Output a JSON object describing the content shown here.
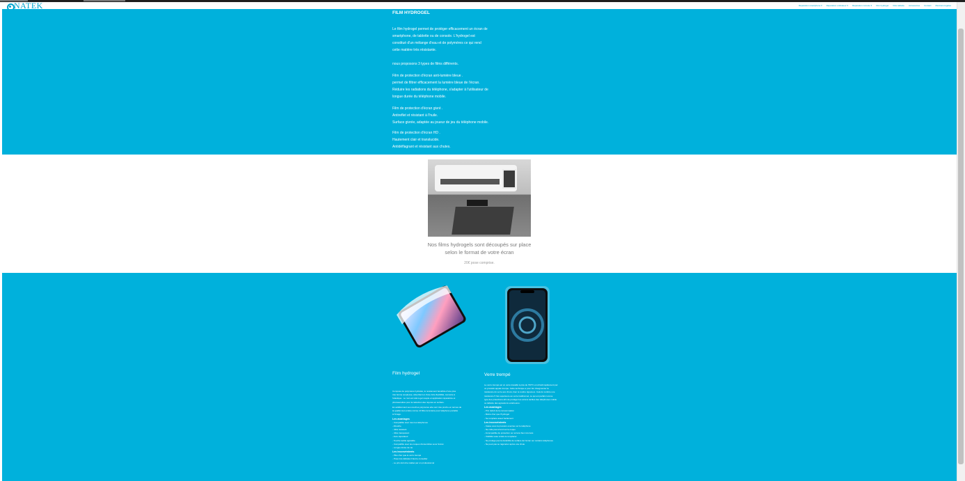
{
  "header": {
    "logo_text": "NATEK",
    "nav": [
      "Réparation smartphone ▾",
      "Réparation ordinateur ▾",
      "Réparation console ▾",
      "Film hydrogel",
      "Vitre tablette",
      "Accessoires",
      "Contact",
      "Mentions légales"
    ]
  },
  "intro": {
    "title": "FILM HYDROGEL",
    "para1_lines": [
      "Le film hydrogel permet de protéger efficacement un écran de",
      "smartphone, de tablette ou de console. L'hydrogel est",
      "constitué d'un mélange d'eau et de polymères ce qui rend",
      "cette matière très résistante."
    ],
    "para2": "nous proposons 3 types de films différents.",
    "para3_lines": [
      "Film de protection d'écran anti-lumière bleue .",
      "permet de filtrer efficacement la lumière bleue de l'écran.",
      "Réduire les radiations du téléphone, s'adapter à l'utilisateur de",
      "longue durée du téléphone mobile."
    ],
    "para4_lines": [
      "Film de protection d'écran givré .",
      "Antireflet et résistant à l'huile.",
      "Surface givrée, adaptée au joueur de jeu du téléphone mobile."
    ],
    "para5_lines": [
      "Film de protection d'écran HD .",
      "Hautement clair et translucide.",
      "Antidéflagrant et résistant aux chutes."
    ]
  },
  "machine_section": {
    "caption_lines": [
      "Nos films hydrogels sont découpés sur place",
      "selon le format de votre écran"
    ],
    "price": "20€ pose comprise."
  },
  "comparison": {
    "hydrogel": {
      "title": "Film hydrogel",
      "text_a": [
        "Composé de polymères hydratés, le revêtement bénéficie d'une plus",
        "très bonne souplesse, absorbant et d'une forte flexibilité, mémoire à",
        "l'élastique . Le mot est relié à gel souple et application réparatrice et",
        "photosensitive pour la réduction des rayures en surface."
      ],
      "text_b": [
        "En additionnant ses couches polymères elle sont très proche en termes de",
        "la qualité tout entière même s'il filtre la lumière pour téléphone portable",
        "à l'image ."
      ],
      "adv_heading": "Les avantages",
      "advantages": [
        "- Compatible avec tous les téléphones",
        "- Absorbe",
        "- Ultra résistant",
        "- Ultra transparent",
        "- Auto-réparateur",
        "- Touche tactile agréable",
        "- Compatible avec les coques d'ensembles sous l'écran",
        "- Longue durée de vie"
      ],
      "dis_heading": "Les inconvénients",
      "disadvantages": [
        "- Plus cher que le verre trempé",
        "- Pose très délicate il faut le conseiller",
        "- Le prix doit être réalisé par un professionnel"
      ]
    },
    "glass": {
      "title": "Verre trempé",
      "text": [
        "Le verre trempé est un verre travaillé à plus de 700°C et refroidi rapidement par",
        "un procédé appelé trempe. Cette technique a pour but d'augmenter la",
        "résistance du verre aux chocs, bien le rendre rigoureux. Cela lui confère une",
        "résistance 5 fois supérieure au verre traditionnel, ce qui est parfait comme",
        "type des protections afin de protéger les écrans tactiles des téléphones mobile",
        "ou tablette des agressions extérieures."
      ],
      "adv_heading": "Les avantages",
      "advantages": [
        "- Prix réduit de la consommation",
        "- Moins cher que l'hydrogel",
        "- Se remplace assez facilement"
      ],
      "dis_heading": "Les inconvénients",
      "disadvantages": [
        "- Casse sous la pression exercée sur le téléphone",
        "- Ne colle pas à bord sur la coque",
        "- Incompatible de protection sur écrans bien incurvés",
        "- Visibilité usée à faire le remplacer",
        "- Ne protège pas la durabilité de surface de l'écran sur certains téléphones",
        "- Ne peut pas se régénérer après une chute"
      ]
    }
  }
}
